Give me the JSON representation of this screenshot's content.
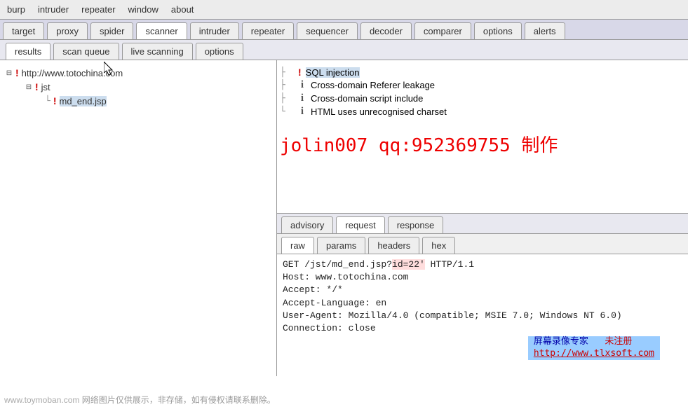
{
  "menubar": [
    "burp",
    "intruder",
    "repeater",
    "window",
    "about"
  ],
  "mainTabs": [
    "target",
    "proxy",
    "spider",
    "scanner",
    "intruder",
    "repeater",
    "sequencer",
    "decoder",
    "comparer",
    "options",
    "alerts"
  ],
  "mainTabActive": "scanner",
  "subTabs": [
    "results",
    "scan queue",
    "live scanning",
    "options"
  ],
  "subTabActive": "results",
  "tree": {
    "root": "http://www.totochina.com",
    "child1": "jst",
    "child2": "md_end.jsp"
  },
  "issues": [
    {
      "sev": "high",
      "label": "SQL injection",
      "sel": true
    },
    {
      "sev": "info",
      "label": "Cross-domain Referer leakage"
    },
    {
      "sev": "info",
      "label": "Cross-domain script include"
    },
    {
      "sev": "info",
      "label": "HTML uses unrecognised charset"
    }
  ],
  "watermark": "jolin007 qq:952369755 制作",
  "detailTabs": [
    "advisory",
    "request",
    "response"
  ],
  "detailTabActive": "request",
  "rawTabs": [
    "raw",
    "params",
    "headers",
    "hex"
  ],
  "rawTabActive": "raw",
  "request": {
    "line1a": "GET /jst/md_end.jsp?",
    "line1b": "id=22'",
    "line1c": " HTTP/1.1",
    "host": "Host: www.totochina.com",
    "accept": "Accept: */*",
    "lang": "Accept-Language: en",
    "ua": "User-Agent: Mozilla/4.0 (compatible; MSIE 7.0; Windows NT 6.0)",
    "conn": "Connection: close"
  },
  "badge": {
    "l1": "屏幕录像专家",
    "r1": "未注册",
    "l2": "http://www.tlxsoft.com"
  },
  "footer": {
    "site": "www.toymoban.com",
    "txt": " 网络图片仅供展示，非存储，如有侵权请联系删除。"
  }
}
